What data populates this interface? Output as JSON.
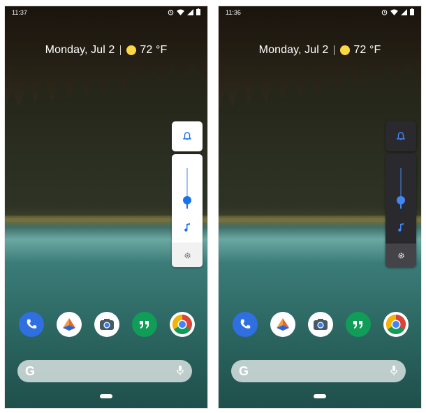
{
  "phones": [
    {
      "id": "left",
      "theme": "light",
      "status": {
        "time": "11:37"
      },
      "glance": {
        "date": "Monday, Jul 2",
        "weather": "72 °F"
      },
      "volume": {
        "media_level": 0.2
      }
    },
    {
      "id": "right",
      "theme": "dark",
      "status": {
        "time": "11:36"
      },
      "glance": {
        "date": "Monday, Jul 2",
        "weather": "72 °F"
      },
      "volume": {
        "media_level": 0.2
      }
    }
  ],
  "dock_apps": [
    "phone-icon",
    "maps-style-icon",
    "camera-icon",
    "hangouts-icon",
    "chrome-icon"
  ],
  "search": {
    "logo": "G"
  },
  "colors": {
    "accent": "#1a73e8",
    "sun": "#fbd745",
    "panel_light": "#ffffff",
    "panel_dark": "#2a2a2e"
  }
}
